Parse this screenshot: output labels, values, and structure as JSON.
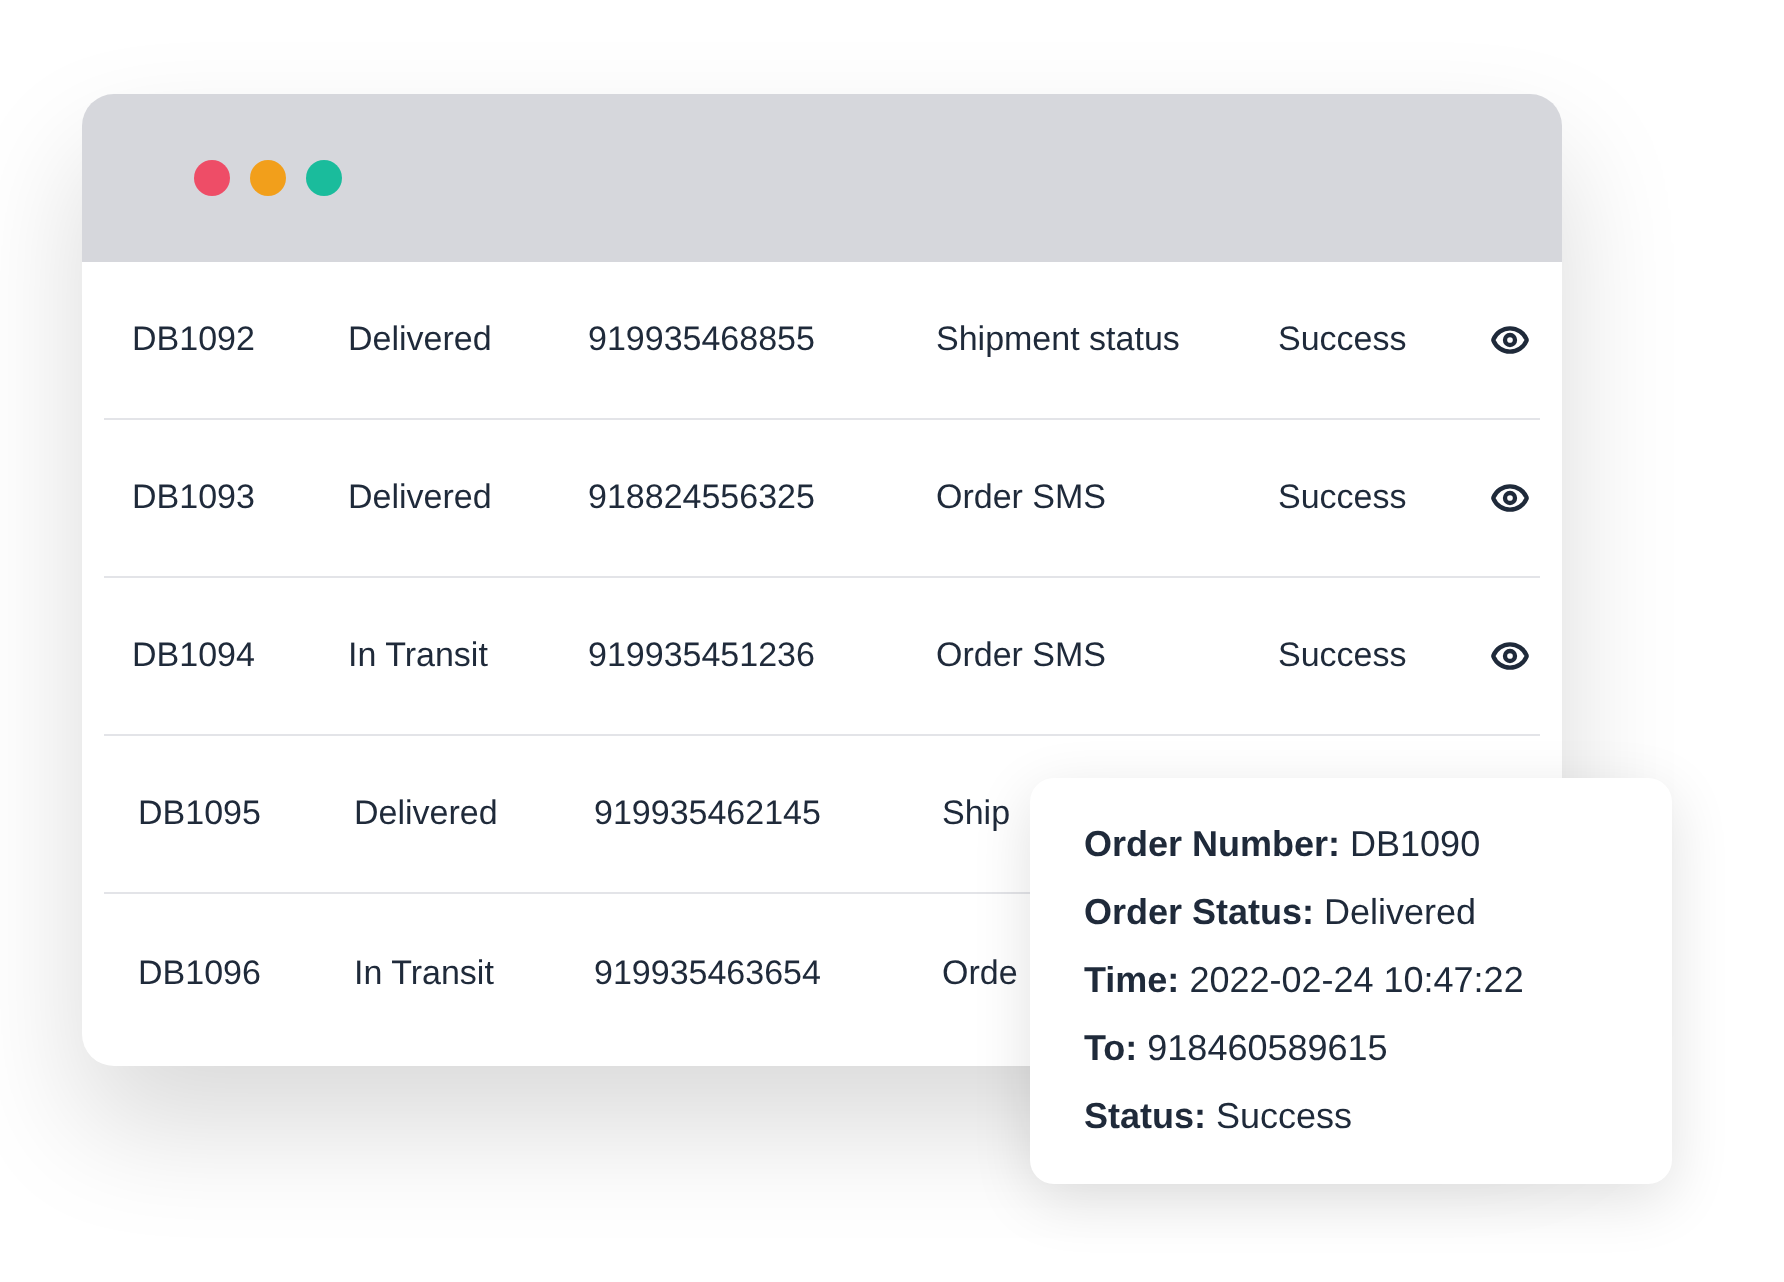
{
  "window": {
    "controls": [
      {
        "color": "#ee4d67"
      },
      {
        "color": "#f29f1b"
      },
      {
        "color": "#1abc9c"
      }
    ]
  },
  "table": {
    "rows": [
      {
        "order": "DB1092",
        "delivery": "Delivered",
        "phone": "919935468855",
        "message": "Shipment status",
        "result": "Success"
      },
      {
        "order": "DB1093",
        "delivery": "Delivered",
        "phone": "918824556325",
        "message": "Order SMS",
        "result": "Success"
      },
      {
        "order": "DB1094",
        "delivery": "In Transit",
        "phone": "919935451236",
        "message": "Order SMS",
        "result": "Success"
      },
      {
        "order": "DB1095",
        "delivery": "Delivered",
        "phone": "919935462145",
        "message": "Ship"
      },
      {
        "order": "DB1096",
        "delivery": "In Transit",
        "phone": "919935463654",
        "message": "Orde"
      }
    ]
  },
  "popup": {
    "lines": [
      "**Order Number:** DB1090",
      "**Order Status:** Delivered",
      "**Time:** 2022-02-24 10:47:22",
      "**To:** 918460589615",
      "**Status:** Success"
    ]
  }
}
